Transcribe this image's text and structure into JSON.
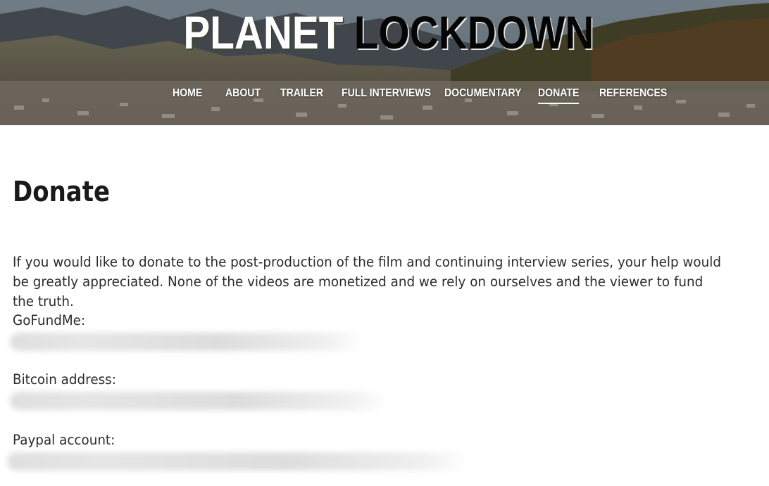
{
  "site": {
    "logo_word_1": "PLANET",
    "logo_word_2": "LOCKDOWN"
  },
  "nav": {
    "items": [
      {
        "label": "HOME",
        "active": false
      },
      {
        "label": "ABOUT",
        "active": false
      },
      {
        "label": "TRAILER",
        "active": false
      },
      {
        "label": "FULL INTERVIEWS",
        "active": false
      },
      {
        "label": "DOCUMENTARY",
        "active": false
      },
      {
        "label": "DONATE",
        "active": true
      },
      {
        "label": "REFERENCES",
        "active": false
      }
    ]
  },
  "page": {
    "title": "Donate",
    "intro": "If you would like to donate to the post-production of the film and continuing interview series, your help would be greatly appreciated. None of the videos are monetized and we rely on ourselves and the viewer to fund the truth.",
    "fields": [
      {
        "label": "GoFundMe:",
        "value_state": "blurred"
      },
      {
        "label": "Bitcoin address:",
        "value_state": "blurred"
      },
      {
        "label": "Paypal account:",
        "value_state": "blurred"
      }
    ]
  },
  "colors": {
    "text": "#2b2b2b",
    "heading": "#1a1a1a",
    "nav_text": "#ffffff",
    "background": "#ffffff"
  }
}
